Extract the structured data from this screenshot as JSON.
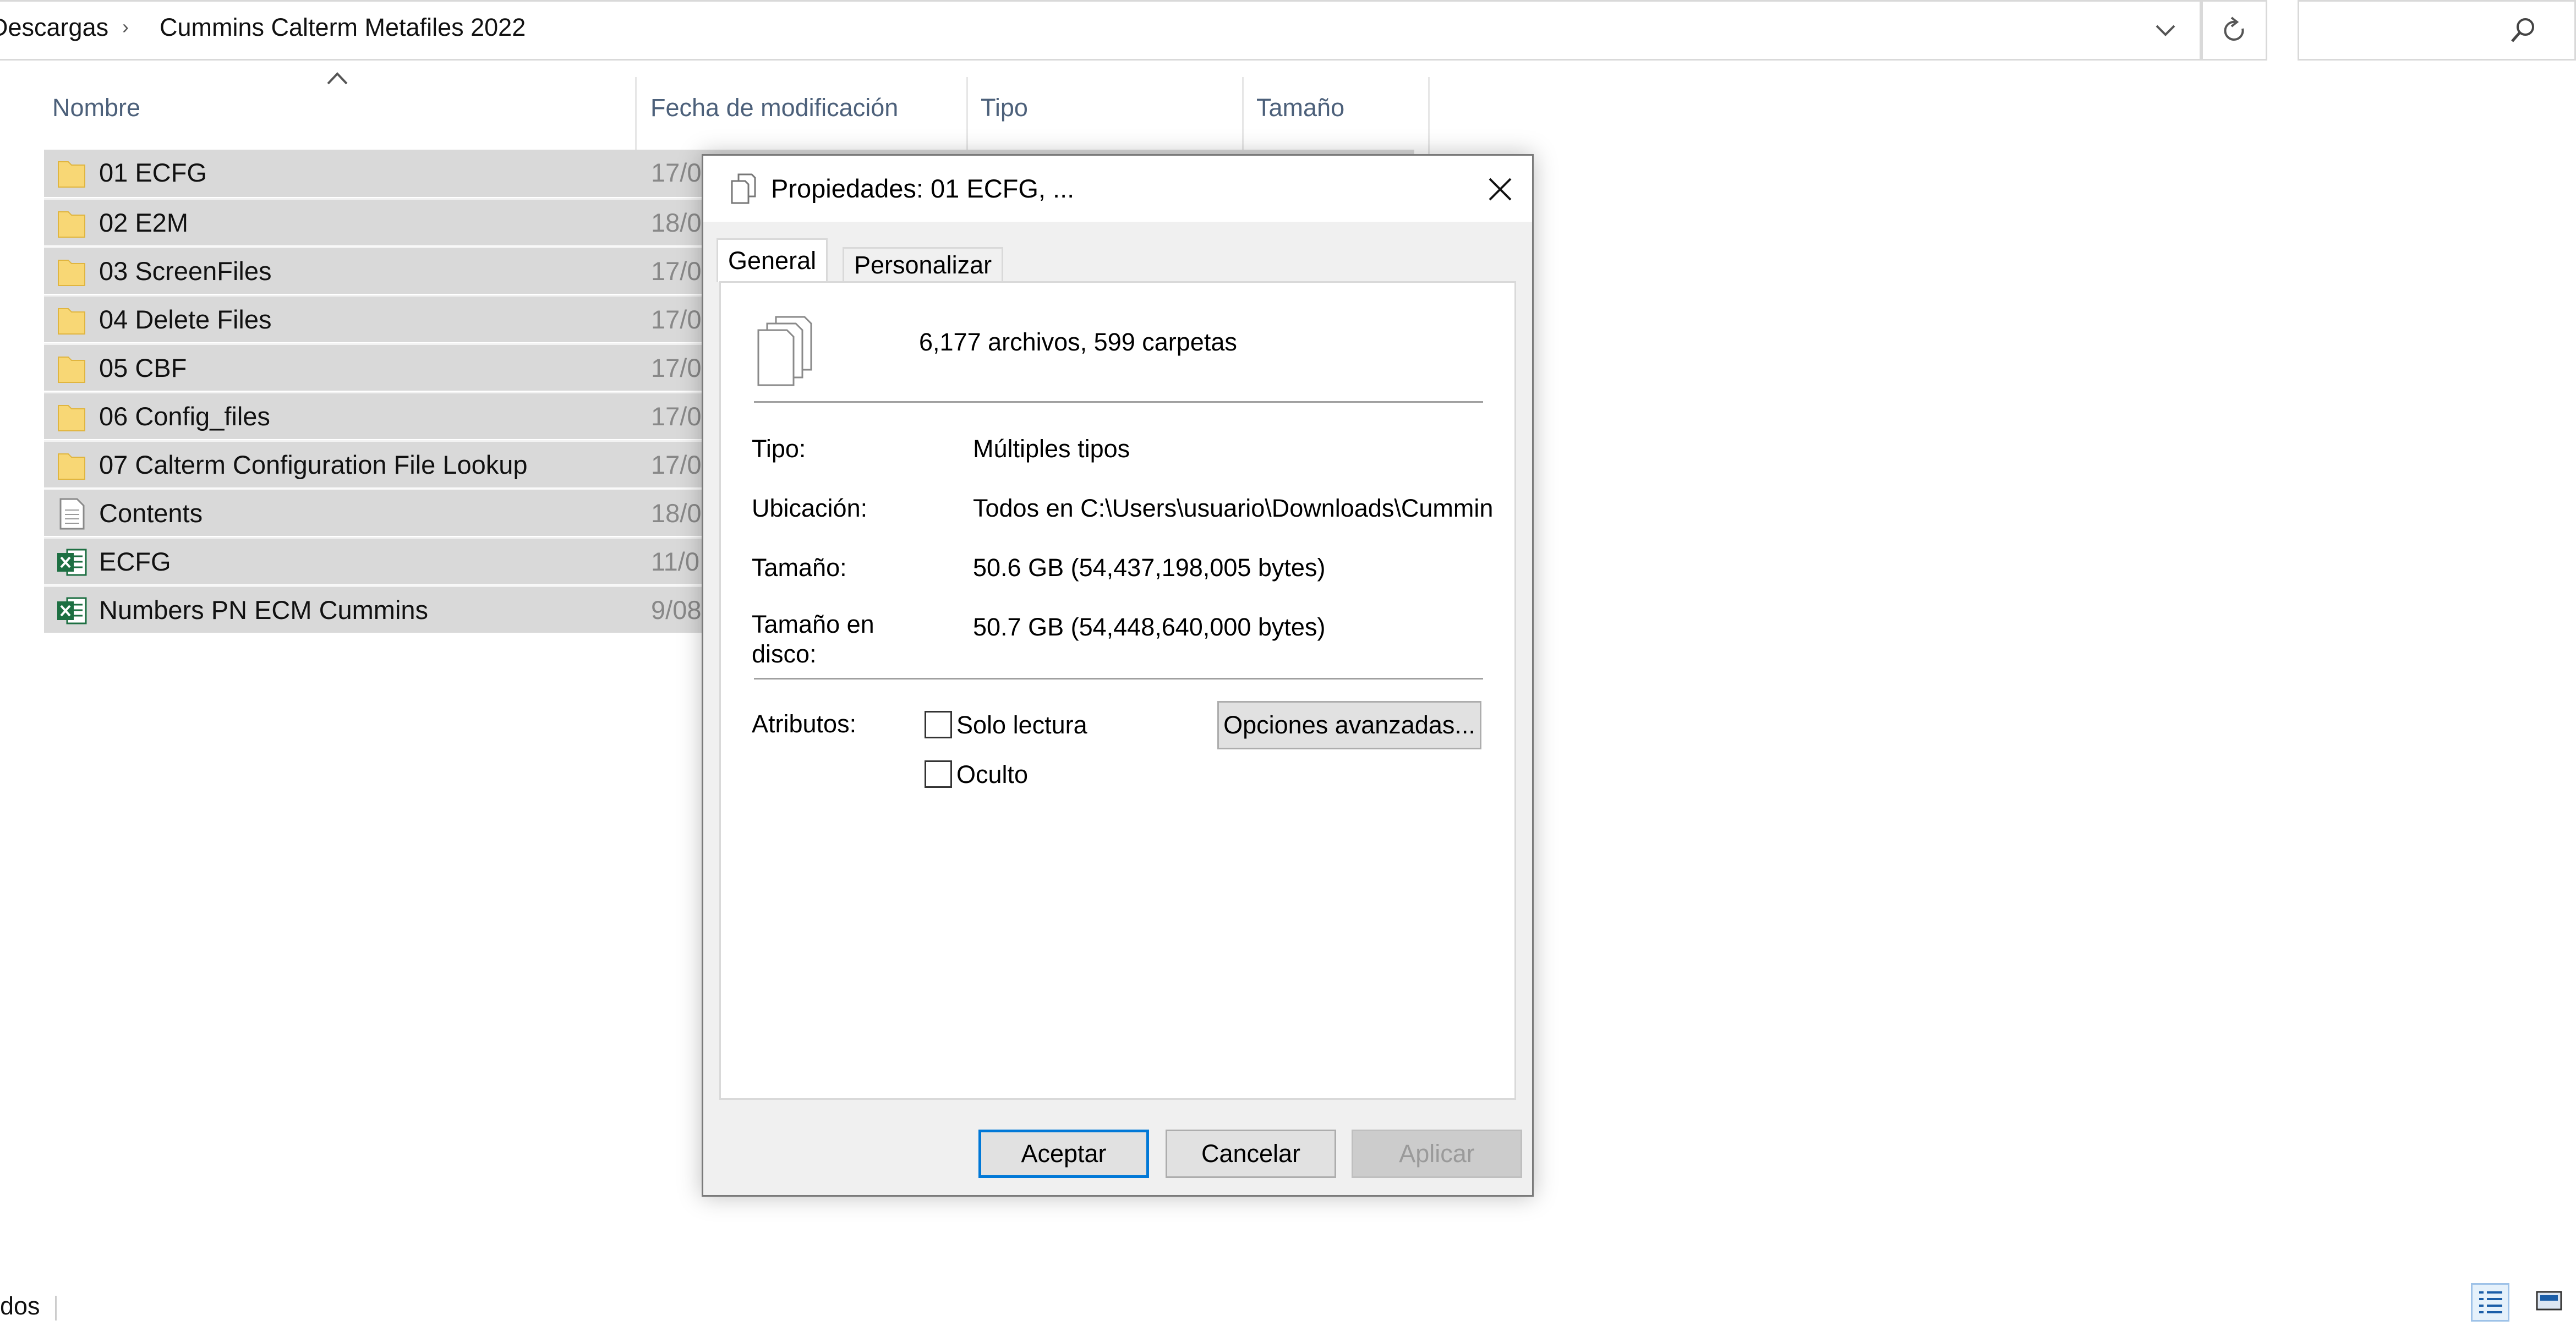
{
  "addressbar": {
    "crumbs": [
      "Descargas",
      "Cummins Calterm Metafiles 2022"
    ],
    "separator": "›"
  },
  "search": {
    "placeholder": ""
  },
  "columns": {
    "name": "Nombre",
    "modified": "Fecha de modificación",
    "type": "Tipo",
    "size": "Tamaño"
  },
  "files": [
    {
      "name": "01 ECFG",
      "date": "17/0",
      "icon": "folder-icon"
    },
    {
      "name": "02 E2M",
      "date": "18/0",
      "icon": "folder-icon"
    },
    {
      "name": "03 ScreenFiles",
      "date": "17/0",
      "icon": "folder-icon"
    },
    {
      "name": "04 Delete Files",
      "date": "17/0",
      "icon": "folder-icon"
    },
    {
      "name": "05 CBF",
      "date": "17/0",
      "icon": "folder-icon"
    },
    {
      "name": "06 Config_files",
      "date": "17/0",
      "icon": "folder-icon"
    },
    {
      "name": "07 Calterm Configuration File Lookup",
      "date": "17/0",
      "icon": "folder-icon"
    },
    {
      "name": "Contents",
      "date": "18/0",
      "icon": "text-file-icon"
    },
    {
      "name": "ECFG",
      "date": "11/0",
      "icon": "excel-file-icon"
    },
    {
      "name": "Numbers  PN ECM Cummins",
      "date": "9/08",
      "icon": "excel-file-icon"
    }
  ],
  "statusbar": {
    "text": "dos"
  },
  "dialog": {
    "title": "Propiedades: 01 ECFG, ...",
    "tabs": [
      "General",
      "Personalizar"
    ],
    "summary": "6,177 archivos, 599 carpetas",
    "props": [
      {
        "label": "Tipo:",
        "value": "Múltiples tipos"
      },
      {
        "label": "Ubicación:",
        "value": "Todos en C:\\Users\\usuario\\Downloads\\Cummin"
      },
      {
        "label": "Tamaño:",
        "value": "50.6 GB (54,437,198,005 bytes)"
      },
      {
        "label": "Tamaño en disco:",
        "value": "50.7 GB (54,448,640,000 bytes)"
      }
    ],
    "attributes_label": "Atributos:",
    "readonly_label": "Solo lectura",
    "hidden_label": "Oculto",
    "readonly_checked": false,
    "hidden_checked": false,
    "advanced_button": "Opciones avanzadas...",
    "ok_button": "Aceptar",
    "cancel_button": "Cancelar",
    "apply_button": "Aplicar"
  }
}
